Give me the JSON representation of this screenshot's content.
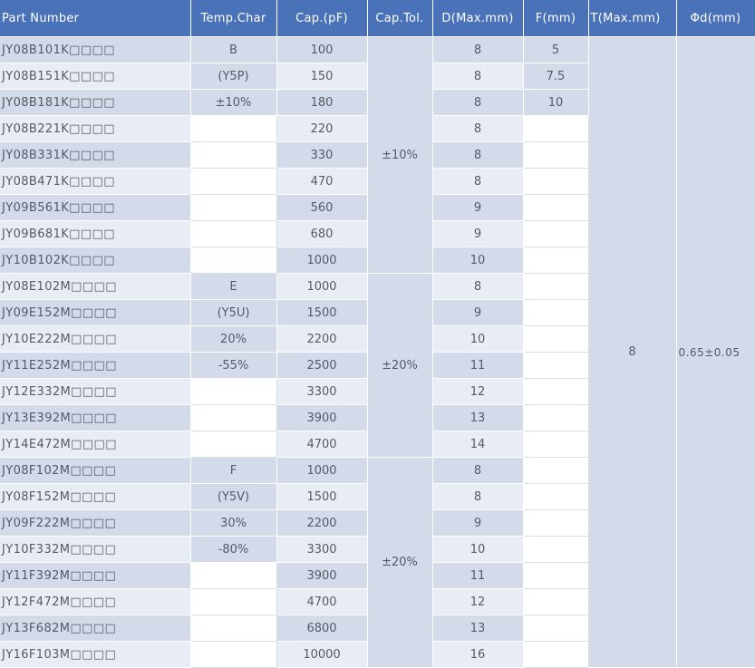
{
  "headers": [
    "Part Number",
    "Temp.Char",
    "Cap.(pF)",
    "Cap.Tol.",
    "D(Max.mm)",
    "F(mm)",
    "T(Max.mm)",
    "Φd(mm)"
  ],
  "rows": [
    {
      "part": "JY08B101K□□□□",
      "temp": "B",
      "cap": "100",
      "d": "8",
      "f": "5"
    },
    {
      "part": "JY08B151K□□□□",
      "temp": "(Y5P)",
      "cap": "150",
      "d": "8",
      "f": "7.5"
    },
    {
      "part": "JY08B181K□□□□",
      "temp": "±10%",
      "cap": "180",
      "d": "8",
      "f": "10"
    },
    {
      "part": "JY08B221K□□□□",
      "temp": "",
      "cap": "220",
      "d": "8",
      "f": ""
    },
    {
      "part": "JY08B331K□□□□",
      "temp": "",
      "cap": "330",
      "d": "8",
      "f": ""
    },
    {
      "part": "JY08B471K□□□□",
      "temp": "",
      "cap": "470",
      "d": "8",
      "f": ""
    },
    {
      "part": "JY09B561K□□□□",
      "temp": "",
      "cap": "560",
      "d": "9",
      "f": ""
    },
    {
      "part": "JY09B681K□□□□",
      "temp": "",
      "cap": "680",
      "d": "9",
      "f": ""
    },
    {
      "part": "JY10B102K□□□□",
      "temp": "",
      "cap": "1000",
      "d": "10",
      "f": ""
    },
    {
      "part": "JY08E102M□□□□",
      "temp": "E",
      "cap": "1000",
      "d": "8",
      "f": ""
    },
    {
      "part": "JY09E152M□□□□",
      "temp": "(Y5U)",
      "cap": "1500",
      "d": "9",
      "f": ""
    },
    {
      "part": "JY10E222M□□□□",
      "temp": "20%",
      "cap": "2200",
      "d": "10",
      "f": ""
    },
    {
      "part": "JY11E252M□□□□",
      "temp": "-55%",
      "cap": "2500",
      "d": "11",
      "f": ""
    },
    {
      "part": "JY12E332M□□□□",
      "temp": "",
      "cap": "3300",
      "d": "12",
      "f": ""
    },
    {
      "part": "JY13E392M□□□□",
      "temp": "",
      "cap": "3900",
      "d": "13",
      "f": ""
    },
    {
      "part": "JY14E472M□□□□",
      "temp": "",
      "cap": "4700",
      "d": "14",
      "f": ""
    },
    {
      "part": "JY08F102M□□□□",
      "temp": "F",
      "cap": "1000",
      "d": "8",
      "f": ""
    },
    {
      "part": "JY08F152M□□□□",
      "temp": "(Y5V)",
      "cap": "1500",
      "d": "8",
      "f": ""
    },
    {
      "part": "JY09F222M□□□□",
      "temp": "30%",
      "cap": "2200",
      "d": "9",
      "f": ""
    },
    {
      "part": "JY10F332M□□□□",
      "temp": "-80%",
      "cap": "3300",
      "d": "10",
      "f": ""
    },
    {
      "part": "JY11F392M□□□□",
      "temp": "",
      "cap": "3900",
      "d": "11",
      "f": ""
    },
    {
      "part": "JY12F472M□□□□",
      "temp": "",
      "cap": "4700",
      "d": "12",
      "f": ""
    },
    {
      "part": "JY13F682M□□□□",
      "temp": "",
      "cap": "6800",
      "d": "13",
      "f": ""
    },
    {
      "part": "JY16F103M□□□□",
      "temp": "",
      "cap": "10000",
      "d": "16",
      "f": ""
    }
  ],
  "tolerance_groups": [
    {
      "label": "±10%",
      "rows": 9
    },
    {
      "label": "±20%",
      "rows": 7
    },
    {
      "label": "±20%",
      "rows": 8
    }
  ],
  "t_value": "8",
  "phi_d_value": "0.65±0.05",
  "colors": {
    "header": "#4a72b8",
    "cell_dark": "#d3dbeb",
    "cell_light": "#e8edf5",
    "text": "#555a66"
  }
}
